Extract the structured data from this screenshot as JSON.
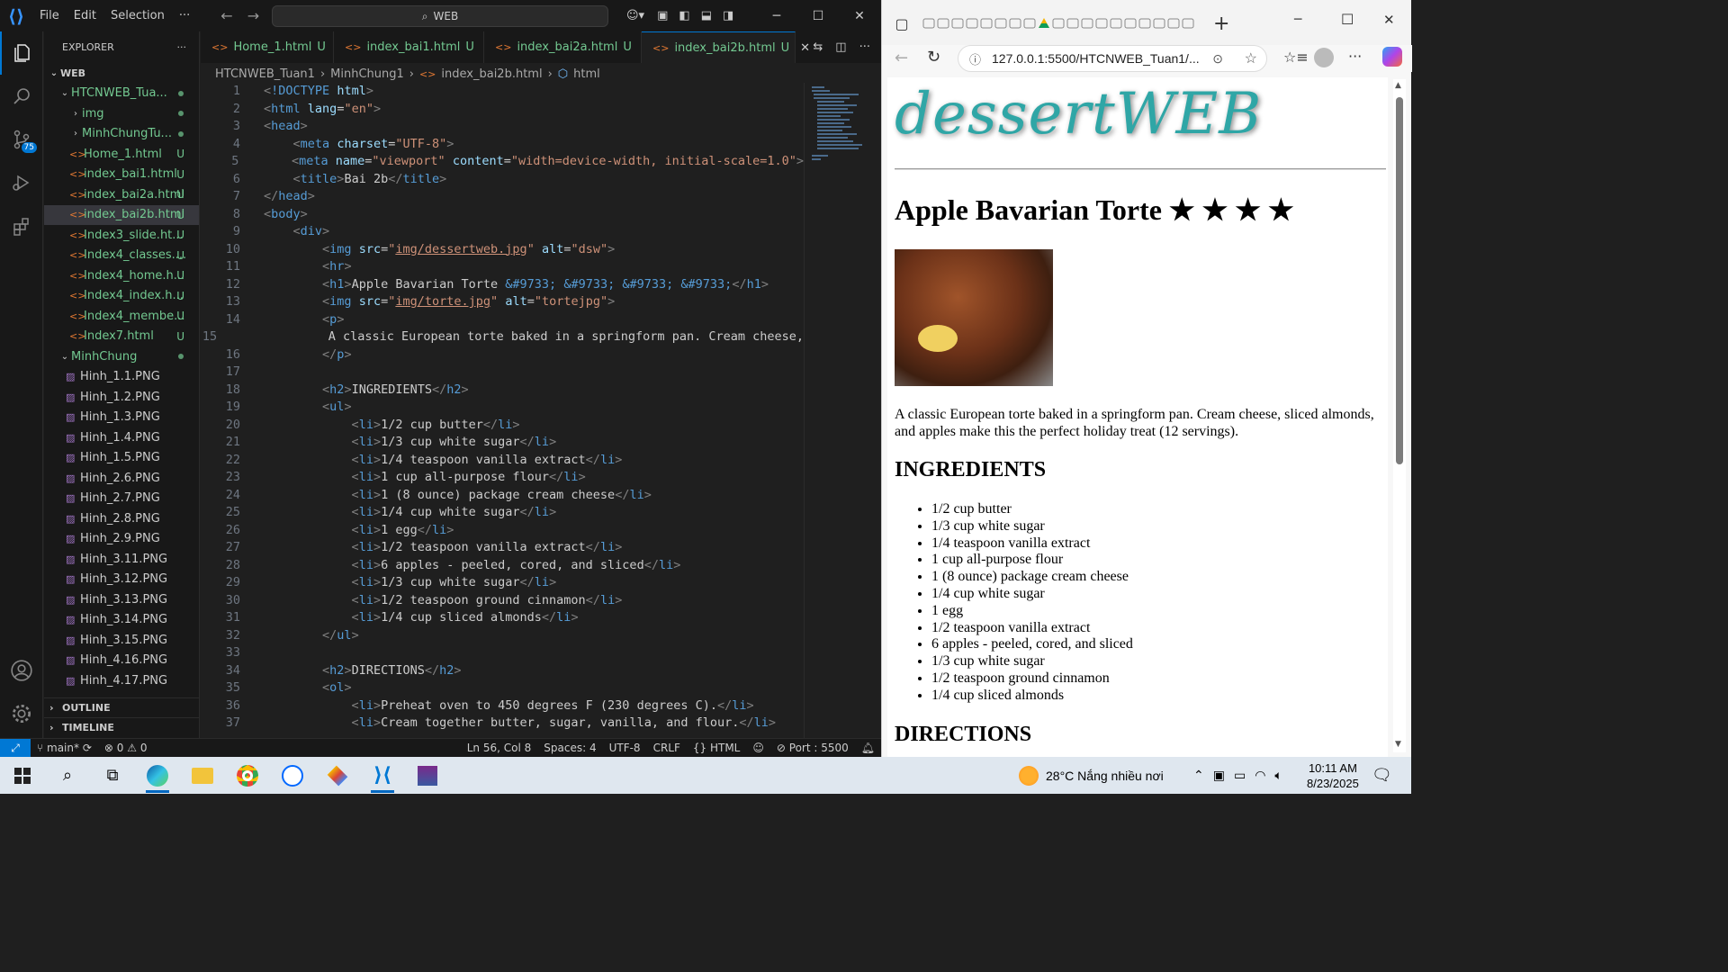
{
  "vscode": {
    "menu": [
      "File",
      "Edit",
      "Selection",
      "···"
    ],
    "command_center": "WEB",
    "scm_badge": "75",
    "explorer": {
      "title": "EXPLORER",
      "workspace": "WEB",
      "folder": "HTCNWEB_Tua...",
      "items": [
        {
          "label": "img",
          "type": "folder",
          "status": ""
        },
        {
          "label": "MinhChungTu...",
          "type": "folder",
          "status": ""
        },
        {
          "label": "Home_1.html",
          "type": "html",
          "status": "U"
        },
        {
          "label": "index_bai1.html",
          "type": "html",
          "status": "U"
        },
        {
          "label": "index_bai2a.html",
          "type": "html",
          "status": "U"
        },
        {
          "label": "index_bai2b.html",
          "type": "html",
          "status": "U"
        },
        {
          "label": "Index3_slide.ht...",
          "type": "html",
          "status": "U"
        },
        {
          "label": "Index4_classes....",
          "type": "html",
          "status": "U"
        },
        {
          "label": "Index4_home.h...",
          "type": "html",
          "status": "U"
        },
        {
          "label": "Index4_index.h...",
          "type": "html",
          "status": "U"
        },
        {
          "label": "Index4_membe...",
          "type": "html",
          "status": "U"
        },
        {
          "label": "Index7.html",
          "type": "html",
          "status": "U"
        }
      ],
      "folder2": "MinhChung",
      "images": [
        "Hinh_1.1.PNG",
        "Hinh_1.2.PNG",
        "Hinh_1.3.PNG",
        "Hinh_1.4.PNG",
        "Hinh_1.5.PNG",
        "Hinh_2.6.PNG",
        "Hinh_2.7.PNG",
        "Hinh_2.8.PNG",
        "Hinh_2.9.PNG",
        "Hinh_3.11.PNG",
        "Hinh_3.12.PNG",
        "Hinh_3.13.PNG",
        "Hinh_3.14.PNG",
        "Hinh_3.15.PNG",
        "Hinh_4.16.PNG",
        "Hinh_4.17.PNG"
      ],
      "outline": "OUTLINE",
      "timeline": "TIMELINE"
    },
    "tabs": [
      {
        "label": "Home_1.html",
        "status": "U"
      },
      {
        "label": "index_bai1.html",
        "status": "U"
      },
      {
        "label": "index_bai2a.html",
        "status": "U"
      },
      {
        "label": "index_bai2b.html",
        "status": "U"
      }
    ],
    "breadcrumb": [
      "HTCNWEB_Tuan1",
      "MinhChung1",
      "index_bai2b.html",
      "html"
    ],
    "status": {
      "branch": "main*",
      "problems": "0",
      "warnings": "0",
      "position": "Ln 56, Col 8",
      "spaces": "Spaces: 4",
      "encoding": "UTF-8",
      "eol": "CRLF",
      "language": "HTML",
      "port": "Port : 5500"
    }
  },
  "browser": {
    "address": "127.0.0.1:5500/HTCNWEB_Tuan1/...",
    "page": {
      "logo_text": "dessertWEB",
      "title": "Apple Bavarian Torte ★ ★ ★ ★",
      "description": "A classic European torte baked in a springform pan. Cream cheese, sliced almonds, and apples make this the perfect holiday treat (12 servings).",
      "ingredients_heading": "INGREDIENTS",
      "ingredients": [
        "1/2 cup butter",
        "1/3 cup white sugar",
        "1/4 teaspoon vanilla extract",
        "1 cup all-purpose flour",
        "1 (8 ounce) package cream cheese",
        "1/4 cup white sugar",
        "1 egg",
        "1/2 teaspoon vanilla extract",
        "6 apples - peeled, cored, and sliced",
        "1/3 cup white sugar",
        "1/2 teaspoon ground cinnamon",
        "1/4 cup sliced almonds"
      ],
      "directions_heading": "DIRECTIONS"
    }
  },
  "taskbar": {
    "weather": "28°C  Nắng nhiều nơi",
    "time": "10:11 AM",
    "date": "8/23/2025"
  },
  "code_lines": [
    "<!DOCTYPE html>",
    "<html lang=\"en\">",
    "<head>",
    "    <meta charset=\"UTF-8\">",
    "    <meta name=\"viewport\" content=\"width=device-width, initial-scale=1.0\">",
    "    <title>Bai 2b</title>",
    "</head>",
    "<body>",
    "    <div>",
    "        <img src=\"img/dessertweb.jpg\" alt=\"dsw\">",
    "        <hr>",
    "        <h1>Apple Bavarian Torte &#9733; &#9733; &#9733; &#9733;</h1>",
    "        <img src=\"img/torte.jpg\" alt=\"tortejpg\">",
    "        <p>",
    "            A classic European torte baked in a springform pan. Cream cheese,",
    "        </p>",
    "",
    "        <h2>INGREDIENTS</h2>",
    "        <ul>",
    "            <li>1/2 cup butter</li>",
    "            <li>1/3 cup white sugar</li>",
    "            <li>1/4 teaspoon vanilla extract</li>",
    "            <li>1 cup all-purpose flour</li>",
    "            <li>1 (8 ounce) package cream cheese</li>",
    "            <li>1/4 cup white sugar</li>",
    "            <li>1 egg</li>",
    "            <li>1/2 teaspoon vanilla extract</li>",
    "            <li>6 apples - peeled, cored, and sliced</li>",
    "            <li>1/3 cup white sugar</li>",
    "            <li>1/2 teaspoon ground cinnamon</li>",
    "            <li>1/4 cup sliced almonds</li>",
    "        </ul>",
    "",
    "        <h2>DIRECTIONS</h2>",
    "        <ol>",
    "            <li>Preheat oven to 450 degrees F (230 degrees C).</li>",
    "            <li>Cream together butter, sugar, vanilla, and flour.</li>"
  ]
}
